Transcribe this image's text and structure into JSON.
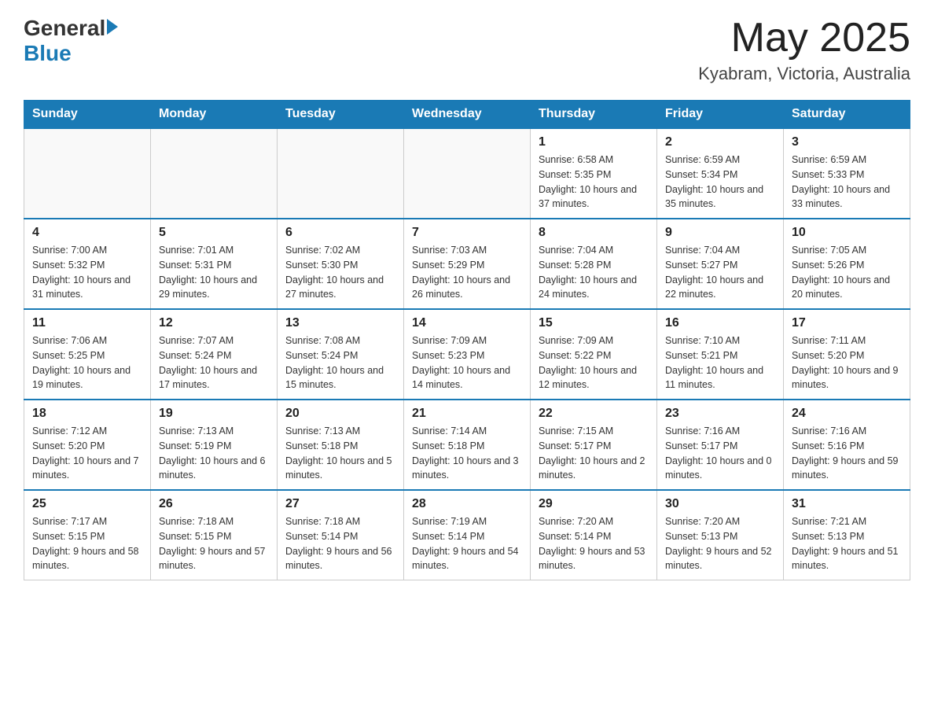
{
  "header": {
    "logo_general": "General",
    "logo_blue": "Blue",
    "month_year": "May 2025",
    "location": "Kyabram, Victoria, Australia"
  },
  "days_of_week": [
    "Sunday",
    "Monday",
    "Tuesday",
    "Wednesday",
    "Thursday",
    "Friday",
    "Saturday"
  ],
  "weeks": [
    [
      {
        "day": "",
        "info": ""
      },
      {
        "day": "",
        "info": ""
      },
      {
        "day": "",
        "info": ""
      },
      {
        "day": "",
        "info": ""
      },
      {
        "day": "1",
        "info": "Sunrise: 6:58 AM\nSunset: 5:35 PM\nDaylight: 10 hours and 37 minutes."
      },
      {
        "day": "2",
        "info": "Sunrise: 6:59 AM\nSunset: 5:34 PM\nDaylight: 10 hours and 35 minutes."
      },
      {
        "day": "3",
        "info": "Sunrise: 6:59 AM\nSunset: 5:33 PM\nDaylight: 10 hours and 33 minutes."
      }
    ],
    [
      {
        "day": "4",
        "info": "Sunrise: 7:00 AM\nSunset: 5:32 PM\nDaylight: 10 hours and 31 minutes."
      },
      {
        "day": "5",
        "info": "Sunrise: 7:01 AM\nSunset: 5:31 PM\nDaylight: 10 hours and 29 minutes."
      },
      {
        "day": "6",
        "info": "Sunrise: 7:02 AM\nSunset: 5:30 PM\nDaylight: 10 hours and 27 minutes."
      },
      {
        "day": "7",
        "info": "Sunrise: 7:03 AM\nSunset: 5:29 PM\nDaylight: 10 hours and 26 minutes."
      },
      {
        "day": "8",
        "info": "Sunrise: 7:04 AM\nSunset: 5:28 PM\nDaylight: 10 hours and 24 minutes."
      },
      {
        "day": "9",
        "info": "Sunrise: 7:04 AM\nSunset: 5:27 PM\nDaylight: 10 hours and 22 minutes."
      },
      {
        "day": "10",
        "info": "Sunrise: 7:05 AM\nSunset: 5:26 PM\nDaylight: 10 hours and 20 minutes."
      }
    ],
    [
      {
        "day": "11",
        "info": "Sunrise: 7:06 AM\nSunset: 5:25 PM\nDaylight: 10 hours and 19 minutes."
      },
      {
        "day": "12",
        "info": "Sunrise: 7:07 AM\nSunset: 5:24 PM\nDaylight: 10 hours and 17 minutes."
      },
      {
        "day": "13",
        "info": "Sunrise: 7:08 AM\nSunset: 5:24 PM\nDaylight: 10 hours and 15 minutes."
      },
      {
        "day": "14",
        "info": "Sunrise: 7:09 AM\nSunset: 5:23 PM\nDaylight: 10 hours and 14 minutes."
      },
      {
        "day": "15",
        "info": "Sunrise: 7:09 AM\nSunset: 5:22 PM\nDaylight: 10 hours and 12 minutes."
      },
      {
        "day": "16",
        "info": "Sunrise: 7:10 AM\nSunset: 5:21 PM\nDaylight: 10 hours and 11 minutes."
      },
      {
        "day": "17",
        "info": "Sunrise: 7:11 AM\nSunset: 5:20 PM\nDaylight: 10 hours and 9 minutes."
      }
    ],
    [
      {
        "day": "18",
        "info": "Sunrise: 7:12 AM\nSunset: 5:20 PM\nDaylight: 10 hours and 7 minutes."
      },
      {
        "day": "19",
        "info": "Sunrise: 7:13 AM\nSunset: 5:19 PM\nDaylight: 10 hours and 6 minutes."
      },
      {
        "day": "20",
        "info": "Sunrise: 7:13 AM\nSunset: 5:18 PM\nDaylight: 10 hours and 5 minutes."
      },
      {
        "day": "21",
        "info": "Sunrise: 7:14 AM\nSunset: 5:18 PM\nDaylight: 10 hours and 3 minutes."
      },
      {
        "day": "22",
        "info": "Sunrise: 7:15 AM\nSunset: 5:17 PM\nDaylight: 10 hours and 2 minutes."
      },
      {
        "day": "23",
        "info": "Sunrise: 7:16 AM\nSunset: 5:17 PM\nDaylight: 10 hours and 0 minutes."
      },
      {
        "day": "24",
        "info": "Sunrise: 7:16 AM\nSunset: 5:16 PM\nDaylight: 9 hours and 59 minutes."
      }
    ],
    [
      {
        "day": "25",
        "info": "Sunrise: 7:17 AM\nSunset: 5:15 PM\nDaylight: 9 hours and 58 minutes."
      },
      {
        "day": "26",
        "info": "Sunrise: 7:18 AM\nSunset: 5:15 PM\nDaylight: 9 hours and 57 minutes."
      },
      {
        "day": "27",
        "info": "Sunrise: 7:18 AM\nSunset: 5:14 PM\nDaylight: 9 hours and 56 minutes."
      },
      {
        "day": "28",
        "info": "Sunrise: 7:19 AM\nSunset: 5:14 PM\nDaylight: 9 hours and 54 minutes."
      },
      {
        "day": "29",
        "info": "Sunrise: 7:20 AM\nSunset: 5:14 PM\nDaylight: 9 hours and 53 minutes."
      },
      {
        "day": "30",
        "info": "Sunrise: 7:20 AM\nSunset: 5:13 PM\nDaylight: 9 hours and 52 minutes."
      },
      {
        "day": "31",
        "info": "Sunrise: 7:21 AM\nSunset: 5:13 PM\nDaylight: 9 hours and 51 minutes."
      }
    ]
  ]
}
